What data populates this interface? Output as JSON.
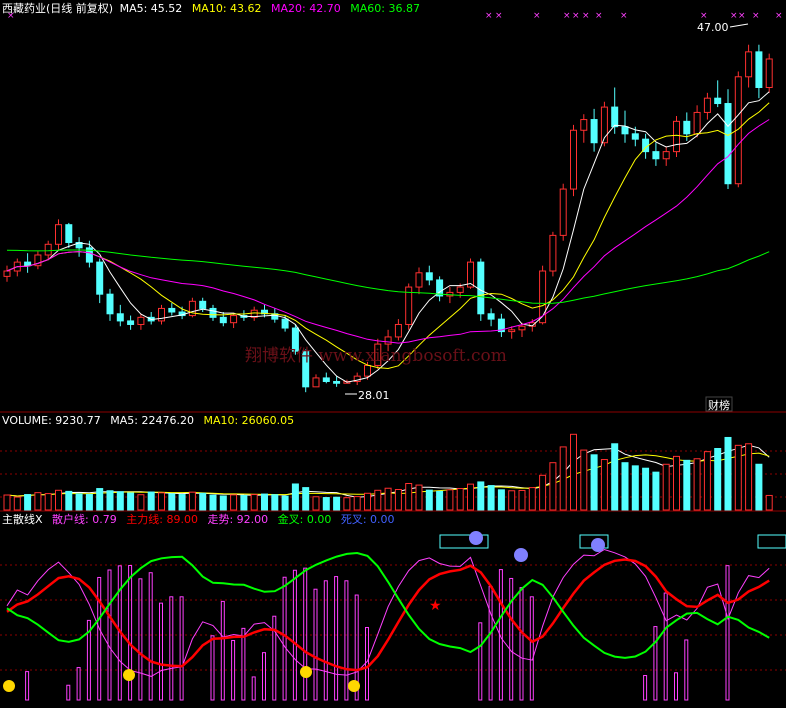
{
  "colors": {
    "bg": "#000000",
    "up": "#ff3030",
    "down": "#54ffff",
    "grid": "#8b0000",
    "ma5": "#ffffff",
    "ma10": "#ffff00",
    "ma20": "#ff00ff",
    "ma60": "#00ff00",
    "retail": "#ff40ff",
    "main": "#ff0000",
    "trend": "#00ff00",
    "gold": "#00ff00",
    "dead": "#4060ff",
    "text": "#ffffff"
  },
  "price_panel": {
    "title": "西藏药业(日线 前复权)",
    "ma5_label": "MA5: 45.52",
    "ma10_label": "MA10: 43.62",
    "ma20_label": "MA20: 42.70",
    "ma60_label": "MA60: 36.87",
    "high_label": "47.00",
    "low_label": "28.01",
    "watermark": "翔博软件 www.xiangbosoft.com",
    "corner_badge": "财榜"
  },
  "volume_panel": {
    "vol_label": "VOLUME: 9230.77",
    "ma5_label": "MA5: 22476.20",
    "ma10_label": "MA10: 26060.05"
  },
  "indicator_panel": {
    "name": "主散线X",
    "retail_label": "散户线: 0.79",
    "main_label": "主力线: 89.00",
    "trend_label": "走势: 92.00",
    "gold_label": "金叉: 0.00",
    "dead_label": "死叉: 0.00"
  },
  "chart_data": [
    {
      "type": "candlestick",
      "series": [
        {
          "name": "MA5",
          "latest": 45.52
        },
        {
          "name": "MA10",
          "latest": 43.62
        },
        {
          "name": "MA20",
          "latest": 42.7
        },
        {
          "name": "MA60",
          "latest": 36.87
        }
      ],
      "annotations": [
        {
          "text": "47.00",
          "value": 47.0
        },
        {
          "text": "28.01",
          "value": 28.01
        }
      ],
      "ohlc": [
        [
          34.0,
          34.6,
          33.7,
          34.3
        ],
        [
          34.3,
          35.0,
          34.0,
          34.8
        ],
        [
          34.8,
          35.3,
          34.2,
          34.6
        ],
        [
          34.6,
          35.4,
          34.4,
          35.2
        ],
        [
          35.2,
          36.0,
          34.9,
          35.8
        ],
        [
          35.8,
          37.2,
          35.5,
          36.9
        ],
        [
          36.9,
          37.0,
          35.6,
          35.9
        ],
        [
          35.9,
          36.2,
          35.1,
          35.6
        ],
        [
          35.6,
          36.0,
          34.5,
          34.8
        ],
        [
          34.8,
          35.0,
          32.5,
          33.0
        ],
        [
          33.0,
          33.3,
          31.5,
          31.9
        ],
        [
          31.9,
          32.4,
          31.2,
          31.5
        ],
        [
          31.5,
          31.8,
          31.0,
          31.3
        ],
        [
          31.3,
          31.9,
          31.0,
          31.7
        ],
        [
          31.7,
          32.0,
          31.3,
          31.5
        ],
        [
          31.5,
          32.4,
          31.3,
          32.2
        ],
        [
          32.2,
          32.5,
          31.8,
          32.0
        ],
        [
          32.0,
          32.3,
          31.6,
          31.8
        ],
        [
          31.8,
          32.8,
          31.7,
          32.6
        ],
        [
          32.6,
          32.8,
          32.0,
          32.2
        ],
        [
          32.2,
          32.4,
          31.5,
          31.7
        ],
        [
          31.7,
          32.0,
          31.2,
          31.4
        ],
        [
          31.4,
          31.9,
          31.1,
          31.8
        ],
        [
          31.8,
          32.1,
          31.5,
          31.7
        ],
        [
          31.7,
          32.3,
          31.5,
          32.1
        ],
        [
          32.1,
          32.4,
          31.7,
          31.9
        ],
        [
          31.9,
          32.2,
          31.4,
          31.6
        ],
        [
          31.6,
          31.8,
          30.9,
          31.1
        ],
        [
          31.1,
          31.3,
          29.6,
          29.8
        ],
        [
          29.8,
          29.9,
          27.5,
          27.8
        ],
        [
          27.8,
          28.5,
          28.0,
          28.3
        ],
        [
          28.3,
          28.6,
          28.0,
          28.1
        ],
        [
          28.1,
          28.4,
          27.8,
          28.0
        ],
        [
          28.0,
          28.2,
          28.01,
          28.1
        ],
        [
          28.1,
          28.6,
          27.9,
          28.4
        ],
        [
          28.4,
          29.2,
          28.2,
          29.0
        ],
        [
          29.0,
          30.5,
          28.8,
          30.2
        ],
        [
          30.2,
          31.0,
          29.8,
          30.6
        ],
        [
          30.6,
          31.6,
          30.4,
          31.3
        ],
        [
          31.3,
          33.6,
          31.0,
          33.4
        ],
        [
          33.4,
          34.5,
          33.0,
          34.2
        ],
        [
          34.2,
          34.6,
          33.5,
          33.8
        ],
        [
          33.8,
          34.0,
          32.6,
          32.9
        ],
        [
          32.9,
          33.4,
          32.5,
          33.1
        ],
        [
          33.1,
          33.6,
          32.8,
          33.4
        ],
        [
          33.4,
          35.0,
          33.3,
          34.8
        ],
        [
          34.8,
          35.0,
          31.5,
          31.9
        ],
        [
          31.9,
          32.2,
          31.2,
          31.6
        ],
        [
          31.6,
          31.9,
          30.6,
          30.9
        ],
        [
          30.9,
          31.2,
          30.5,
          31.0
        ],
        [
          31.0,
          31.4,
          30.6,
          31.2
        ],
        [
          31.2,
          31.6,
          30.9,
          31.4
        ],
        [
          31.4,
          34.6,
          31.3,
          34.3
        ],
        [
          34.3,
          36.5,
          34.0,
          36.3
        ],
        [
          36.3,
          39.2,
          36.0,
          38.9
        ],
        [
          38.9,
          42.5,
          38.5,
          42.2
        ],
        [
          42.2,
          43.1,
          41.5,
          42.8
        ],
        [
          42.8,
          43.4,
          41.0,
          41.5
        ],
        [
          41.5,
          43.8,
          41.3,
          43.5
        ],
        [
          43.5,
          44.6,
          42.0,
          42.4
        ],
        [
          42.4,
          43.3,
          41.5,
          42.0
        ],
        [
          42.0,
          42.4,
          41.3,
          41.7
        ],
        [
          41.7,
          42.0,
          40.6,
          41.0
        ],
        [
          41.0,
          41.5,
          40.2,
          40.6
        ],
        [
          40.6,
          41.3,
          40.2,
          41.0
        ],
        [
          41.0,
          43.0,
          40.7,
          42.7
        ],
        [
          42.7,
          43.2,
          41.6,
          42.0
        ],
        [
          42.0,
          43.6,
          41.8,
          43.2
        ],
        [
          43.2,
          44.3,
          42.8,
          44.0
        ],
        [
          44.0,
          45.0,
          43.5,
          43.7
        ],
        [
          43.7,
          44.5,
          38.9,
          39.2
        ],
        [
          39.2,
          45.5,
          39.0,
          45.2
        ],
        [
          45.2,
          47.0,
          44.6,
          46.6
        ],
        [
          46.6,
          47.0,
          44.0,
          44.6
        ],
        [
          44.6,
          46.5,
          44.3,
          46.2
        ]
      ]
    },
    {
      "type": "bar",
      "series": [
        {
          "name": "VOLUME",
          "latest": 9230.77
        },
        {
          "name": "MA5",
          "latest": 22476.2
        },
        {
          "name": "MA10",
          "latest": 26060.05
        }
      ],
      "values": [
        9500,
        8200,
        9800,
        11000,
        10400,
        12500,
        11800,
        10200,
        9900,
        13600,
        12200,
        11600,
        10800,
        9700,
        11400,
        10900,
        10200,
        9800,
        11300,
        10600,
        9400,
        8900,
        9600,
        9200,
        9800,
        10100,
        9700,
        8800,
        16500,
        14200,
        8400,
        7900,
        8100,
        7800,
        8500,
        10600,
        12500,
        13800,
        13000,
        16800,
        15800,
        12600,
        11800,
        12800,
        13600,
        16400,
        17800,
        15500,
        12800,
        12200,
        12400,
        14200,
        22000,
        30000,
        40000,
        48000,
        38000,
        35000,
        32000,
        42000,
        30000,
        28000,
        26500,
        24000,
        29000,
        34000,
        31500,
        32500,
        37000,
        39000,
        46000,
        41000,
        42000,
        29000,
        9230.77
      ]
    },
    {
      "type": "line",
      "series": [
        {
          "name": "散户线",
          "latest": 0.79
        },
        {
          "name": "主力线",
          "latest": 89.0
        },
        {
          "name": "走势",
          "latest": 92.0
        },
        {
          "name": "金叉",
          "latest": 0.0
        },
        {
          "name": "死叉",
          "latest": 0.0
        }
      ]
    }
  ]
}
